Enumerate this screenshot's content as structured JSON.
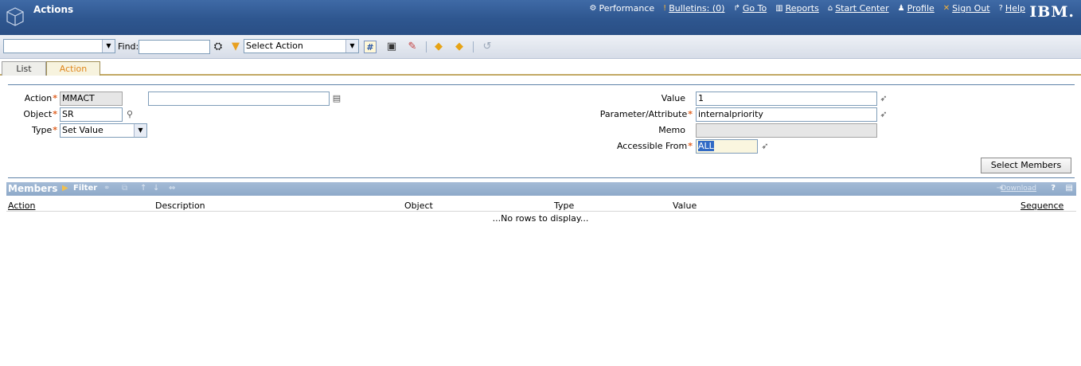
{
  "header": {
    "app_title": "Actions",
    "brand": "IBM.",
    "nav": [
      {
        "label": "Performance",
        "icon": "performance-icon"
      },
      {
        "label": "Bulletins: (0)",
        "icon": "bulletin-icon"
      },
      {
        "label": "Go To",
        "icon": "goto-arrow-icon"
      },
      {
        "label": "Reports",
        "icon": "reports-icon"
      },
      {
        "label": "Start Center",
        "icon": "home-icon"
      },
      {
        "label": "Profile",
        "icon": "profile-icon"
      },
      {
        "label": "Sign Out",
        "icon": "sign-out-icon"
      },
      {
        "label": "Help",
        "icon": "help-icon"
      }
    ]
  },
  "toolbar": {
    "query_select_value": "",
    "find_label": "Find:",
    "find_value": "",
    "action_select_value": "Select Action"
  },
  "tabs": [
    {
      "label": "List",
      "active": false
    },
    {
      "label": "Action",
      "active": true
    }
  ],
  "form": {
    "action_label": "Action",
    "action_value": "MMACT",
    "action_desc_value": "",
    "object_label": "Object",
    "object_value": "SR",
    "type_label": "Type",
    "type_value": "Set Value",
    "value_label": "Value",
    "value_value": "1",
    "param_label": "Parameter/Attribute",
    "param_value": "internalpriority",
    "memo_label": "Memo",
    "memo_value": "",
    "accessible_label": "Accessible From",
    "accessible_value": "ALL",
    "required_mark": "*",
    "select_members_label": "Select Members"
  },
  "members": {
    "title": "Members",
    "filter_label": "Filter",
    "download_label": "Download",
    "columns": [
      "Action",
      "Description",
      "Object",
      "Type",
      "Value",
      "Sequence"
    ],
    "empty_text": "...No rows to display..."
  },
  "colors": {
    "header_bg": "#2e568f",
    "tab_active_text": "#e0861b",
    "required": "#e06020",
    "section_bar": "#8ea9c9"
  }
}
